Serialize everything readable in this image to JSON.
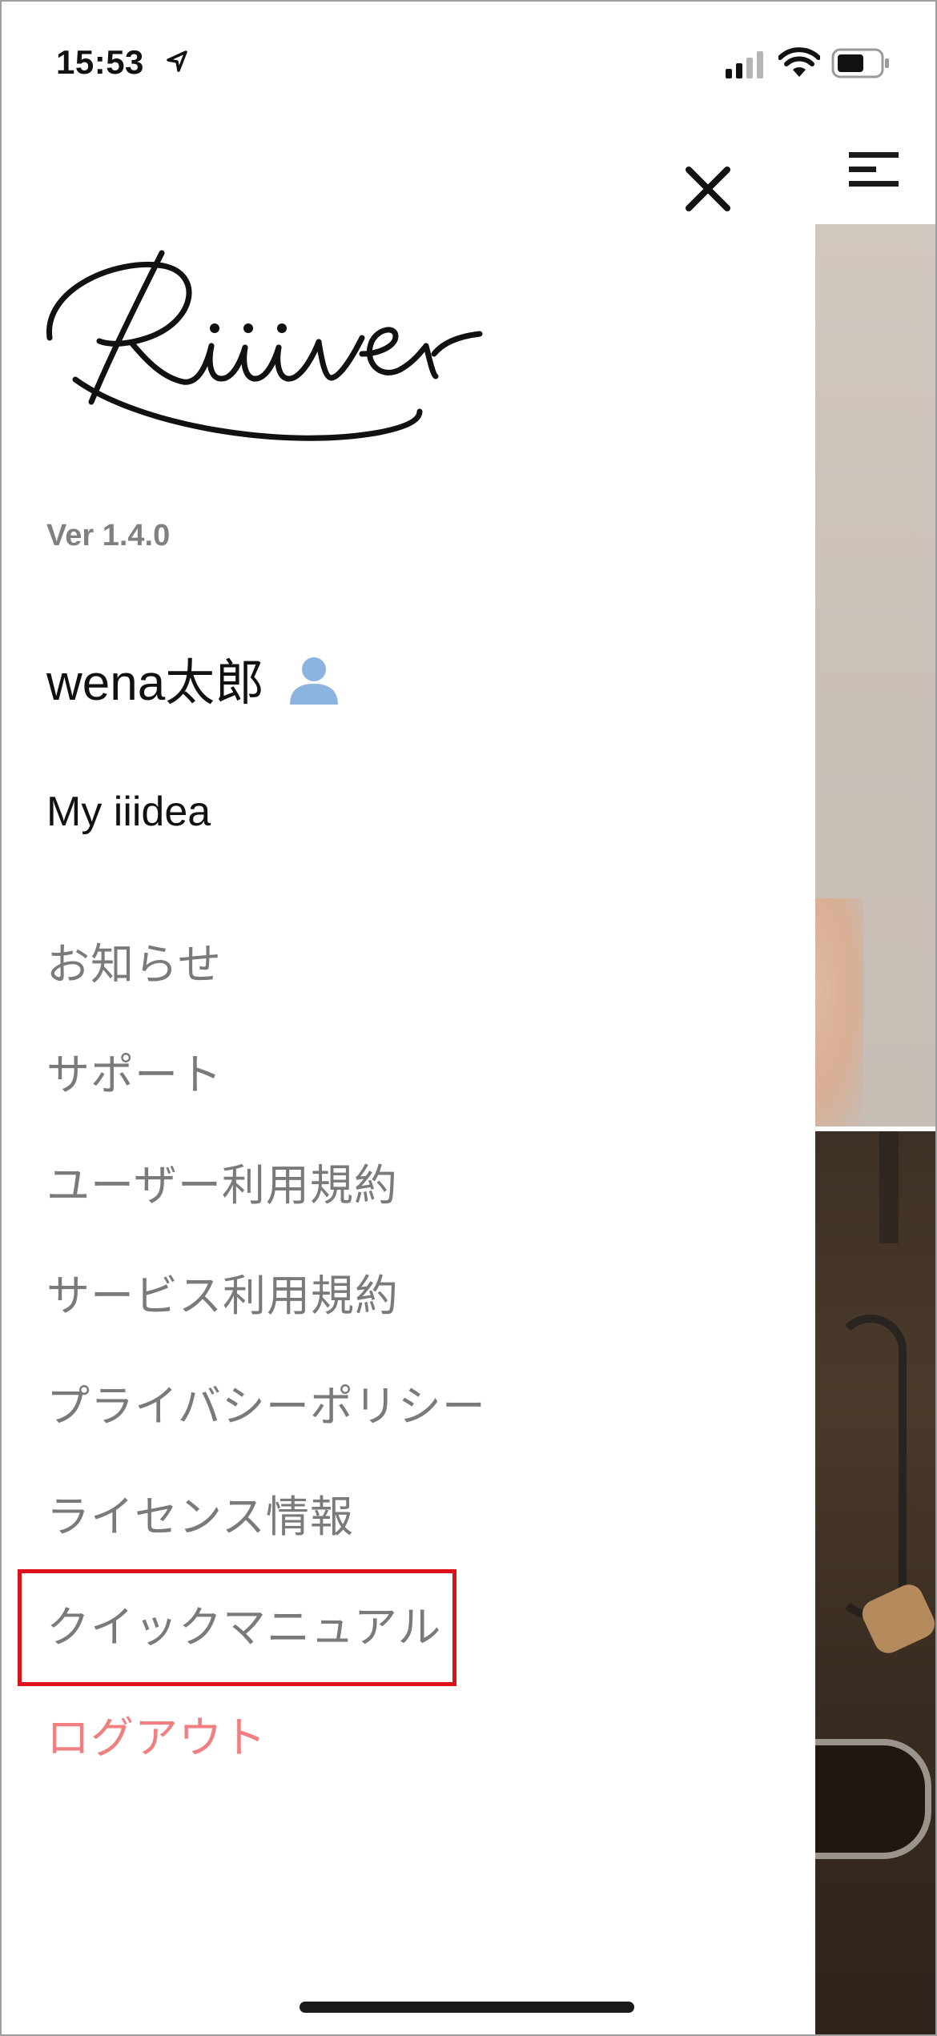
{
  "status_bar": {
    "time": "15:53"
  },
  "drawer": {
    "logo_text": "Riiiver",
    "version": "Ver 1.4.0",
    "user_name": "wena太郎",
    "my_iiidea": "My iiidea",
    "menu": [
      {
        "label": "お知らせ"
      },
      {
        "label": "サポート"
      },
      {
        "label": "ユーザー利用規約"
      },
      {
        "label": "サービス利用規約"
      },
      {
        "label": "プライバシーポリシー"
      },
      {
        "label": "ライセンス情報"
      },
      {
        "label": "クイックマニュアル"
      },
      {
        "label": "ログアウト"
      }
    ]
  },
  "icons": {
    "close": "close-icon",
    "hamburger": "hamburger-menu-icon",
    "user": "user-icon",
    "location": "location-arrow-icon",
    "signal": "cellular-signal-icon",
    "wifi": "wifi-icon",
    "battery": "battery-icon"
  },
  "colors": {
    "logout": "#f07f80",
    "menu_text": "#7a7a7a",
    "user_icon": "#8db3df",
    "highlight_box": "#e0101a"
  },
  "annotation": {
    "highlighted_item": "クイックマニュアル"
  }
}
